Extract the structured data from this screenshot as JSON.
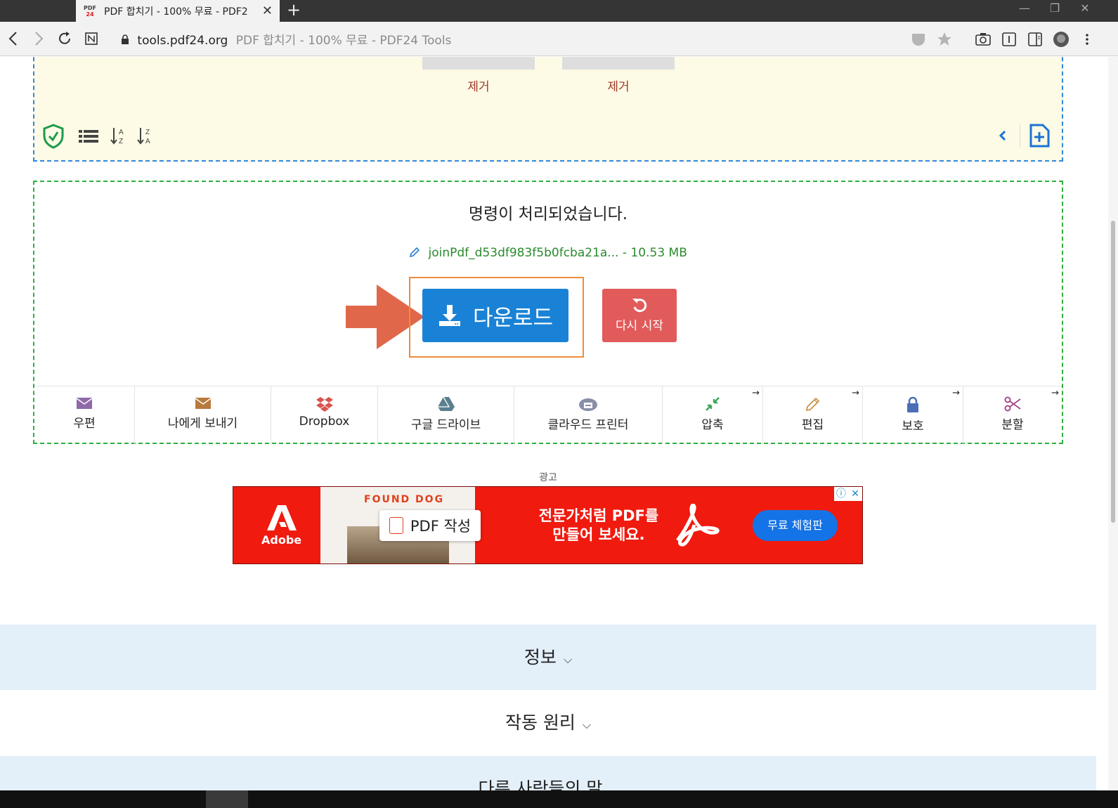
{
  "browser": {
    "tab": {
      "favicon_top": "PDF",
      "favicon_bottom": "24",
      "title": "PDF 합치기 - 100% 무료 - PDF2",
      "close": "✕"
    },
    "new_tab": "+",
    "window_controls": {
      "minimize": "—",
      "restore": "❐",
      "close": "✕"
    },
    "address": {
      "host": "tools.pdf24.org",
      "page_title": "PDF 합치기 - 100% 무료 - PDF24 Tools"
    }
  },
  "files": {
    "remove_labels": [
      "제거",
      "제거"
    ]
  },
  "result": {
    "message": "명령이 처리되었습니다.",
    "file": "joinPdf_d53df983f5b0fcba21a... - 10.53 MB",
    "download_label": "다운로드",
    "restart_label": "다시 시작"
  },
  "actions": [
    {
      "label": "우편",
      "icon": "mail-icon",
      "color": "#8e6aa8",
      "next": ""
    },
    {
      "label": "나에게 보내기",
      "icon": "mail-icon",
      "color": "#b87a3c",
      "next": ""
    },
    {
      "label": "Dropbox",
      "icon": "dropbox-icon",
      "color": "#d9534f",
      "next": ""
    },
    {
      "label": "구글 드라이브",
      "icon": "drive-icon",
      "color": "#5a7f8f",
      "next": ""
    },
    {
      "label": "클라우드 프린터",
      "icon": "cloud-printer-icon",
      "color": "#8a8fa8",
      "next": ""
    },
    {
      "label": "압축",
      "icon": "compress-icon",
      "color": "#3aa655",
      "next": "→"
    },
    {
      "label": "편집",
      "icon": "pencil-icon",
      "color": "#c9954a",
      "next": "→"
    },
    {
      "label": "보호",
      "icon": "lock-icon",
      "color": "#4a6fb5",
      "next": "→"
    },
    {
      "label": "분할",
      "icon": "scissors-icon",
      "color": "#a84a8e",
      "next": "→"
    }
  ],
  "ad": {
    "label": "광고",
    "brand": "Adobe",
    "card_title": "FOUND DOG",
    "pill_text": "PDF 작성",
    "headline_line1": "전문가처럼 PDF를",
    "headline_line2": "만들어 보세요.",
    "cta": "무료 체험판",
    "adchoices_info": "ⓘ",
    "adchoices_close": "✕"
  },
  "faq": [
    {
      "label": "정보",
      "chevron": "⌵"
    },
    {
      "label": "작동 원리",
      "chevron": "⌵"
    },
    {
      "label": "다른 사람들의 말",
      "chevron": "⌵"
    }
  ],
  "colors": {
    "files_border": "#2f86e0",
    "result_border": "#2eb03d",
    "download": "#1a82d6",
    "restart": "#e25b5b",
    "highlight": "#ef8c3b",
    "arrow": "#e0674a"
  }
}
